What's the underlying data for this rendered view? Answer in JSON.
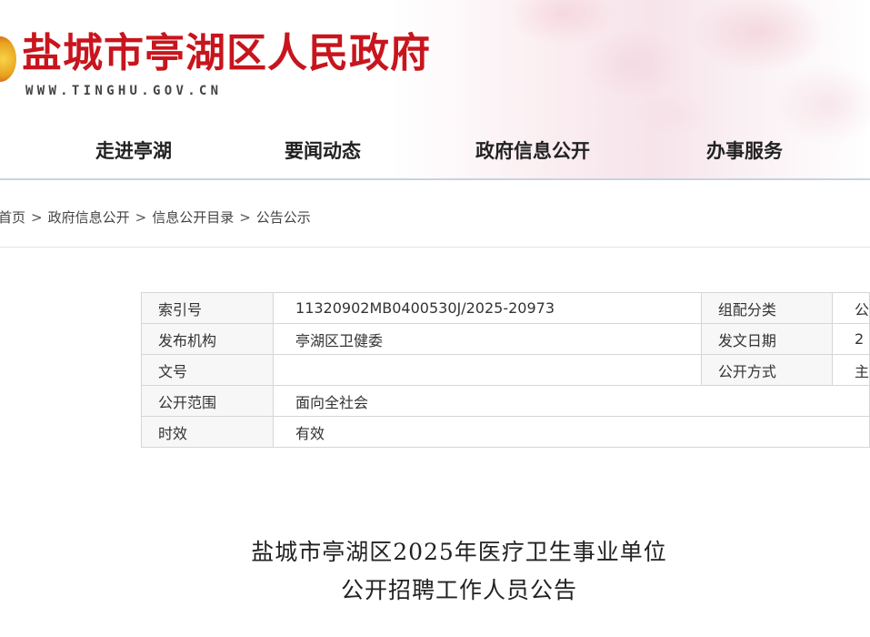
{
  "header": {
    "title": "盐城市亭湖区人民政府",
    "url": "WWW.TINGHU.GOV.CN",
    "colors": {
      "title": "#c8151d",
      "nav_line": "#c9d3df"
    },
    "emblem_icon": "city-emblem-icon"
  },
  "nav": {
    "items": [
      {
        "label": "走进亭湖"
      },
      {
        "label": "要闻动态"
      },
      {
        "label": "政府信息公开"
      },
      {
        "label": "办事服务"
      }
    ]
  },
  "breadcrumb": {
    "items": [
      "首页",
      "政府信息公开",
      "信息公开目录",
      "公告公示"
    ],
    "separator": ">"
  },
  "meta_table": {
    "rows": [
      {
        "label": "索引号",
        "value": "11320902MB0400530J/2025-20973",
        "label2": "组配分类",
        "value2": "公"
      },
      {
        "label": "发布机构",
        "value": "亭湖区卫健委",
        "label2": "发文日期",
        "value2": "2"
      },
      {
        "label": "文号",
        "value": "",
        "label2": "公开方式",
        "value2": "主"
      },
      {
        "label": "公开范围",
        "value": "面向全社会"
      },
      {
        "label": "时效",
        "value": "有效"
      }
    ]
  },
  "article": {
    "title_line1": "盐城市亭湖区2025年医疗卫生事业单位",
    "title_line2": "公开招聘工作人员公告"
  }
}
